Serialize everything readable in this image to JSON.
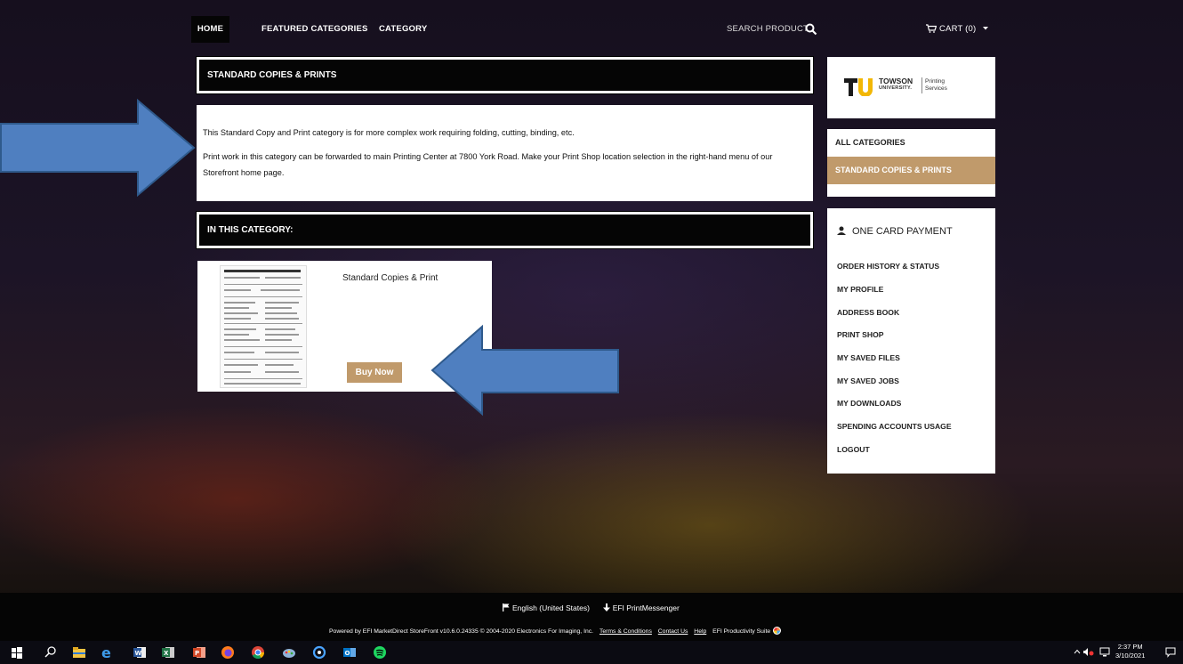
{
  "nav": {
    "home": "HOME",
    "featured": "FEATURED CATEGORIES",
    "category": "CATEGORY",
    "search_label": "SEARCH PRODUCT",
    "cart": "CART (0)"
  },
  "main": {
    "section_title": "STANDARD COPIES & PRINTS",
    "description_p1": "This Standard Copy and Print category is for more complex work requiring folding, cutting, binding, etc.",
    "description_p2": "Print work in this category can be forwarded to main Printing Center at 7800 York Road.  Make your Print Shop location selection in the right-hand menu of our Storefront home page.",
    "in_category_title": "IN THIS CATEGORY:",
    "product": {
      "name": "Standard Copies & Print",
      "buy_label": "Buy Now"
    }
  },
  "sidebar": {
    "logo": {
      "line1": "TOWSON",
      "line2": "UNIVERSITY.",
      "line3a": "Printing",
      "line3b": "Services"
    },
    "categories": [
      {
        "label": "ALL CATEGORIES",
        "active": false
      },
      {
        "label": "STANDARD COPIES & PRINTS",
        "active": true
      }
    ],
    "account": {
      "title": "ONE CARD PAYMENT",
      "links": [
        "ORDER HISTORY & STATUS",
        "MY PROFILE",
        "ADDRESS BOOK",
        "PRINT SHOP",
        "MY SAVED FILES",
        "MY SAVED JOBS",
        "MY DOWNLOADS",
        "SPENDING ACCOUNTS USAGE",
        "LOGOUT"
      ]
    }
  },
  "footer": {
    "language": "English (United States)",
    "messenger": "EFI PrintMessenger",
    "powered": "Powered by EFI MarketDirect StoreFront  v10.6.0.24335  © 2004-2020 Electronics For Imaging, Inc.",
    "terms": "Terms & Conditions",
    "contact": "Contact Us",
    "help": "Help",
    "suite": "EFI Productivity Suite"
  },
  "taskbar": {
    "time": "2:37 PM",
    "date": "3/10/2021",
    "icons": [
      "windows-start-icon",
      "search-icon",
      "file-explorer-icon",
      "edge-icon",
      "word-icon",
      "excel-icon",
      "powerpoint-icon",
      "firefox-icon",
      "chrome-icon",
      "paint-icon",
      "photos-icon",
      "outlook-icon",
      "spotify-icon"
    ]
  },
  "colors": {
    "accent": "#c09a6b",
    "header_bg": "#050505",
    "arrow": "#4f7fc0"
  }
}
